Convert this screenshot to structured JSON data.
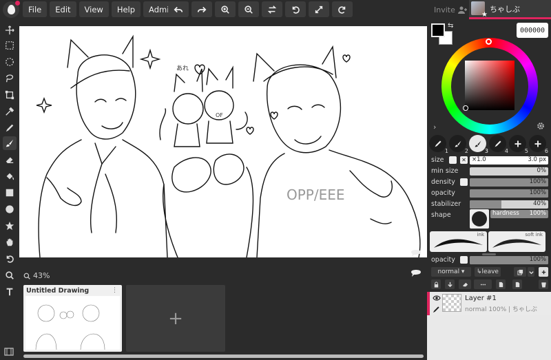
{
  "menu": {
    "file": "File",
    "edit": "Edit",
    "view": "View",
    "help": "Help",
    "admin": "Admin"
  },
  "header": {
    "invite": "Invite",
    "username": "ちゃしぶ"
  },
  "canvas": {
    "zoom": "43%",
    "drawing_text": "OPP/EEE",
    "small_text_1": "あれ",
    "small_text_2": "OF"
  },
  "documents": [
    {
      "title": "Untitled Drawing",
      "menu_glyph": "⋮"
    }
  ],
  "add_document_glyph": "+",
  "color": {
    "hex": "000000",
    "fg": "#000000",
    "bg": "#ffffff"
  },
  "brushes": [
    {
      "num": "1"
    },
    {
      "num": "2"
    },
    {
      "num": "3"
    },
    {
      "num": "4"
    },
    {
      "num": "5"
    },
    {
      "num": "6"
    }
  ],
  "brush_props": {
    "size_label": "size",
    "size_mult": "×1.0",
    "size_value": "3.0 px",
    "x_glyph": "✕",
    "min_size_label": "min size",
    "min_size_value": "0%",
    "density_label": "density",
    "density_value": "100%",
    "opacity_label": "opacity",
    "opacity_value": "100%",
    "stabilizer_label": "stabilizer",
    "stabilizer_value": "40%",
    "shape_label": "shape",
    "hardness_label": "hardness",
    "hardness_value": "100%"
  },
  "presets": [
    {
      "name": "ink"
    },
    {
      "name": "soft ink"
    }
  ],
  "layer_opacity": {
    "label": "opacity",
    "value": "100%"
  },
  "layer_controls": {
    "blend": "normal ▾",
    "leave": "↳leave"
  },
  "layers": [
    {
      "name": "Layer #1",
      "meta": "normal 100% | ちゃしぶ"
    }
  ],
  "accent": "#e0245e"
}
